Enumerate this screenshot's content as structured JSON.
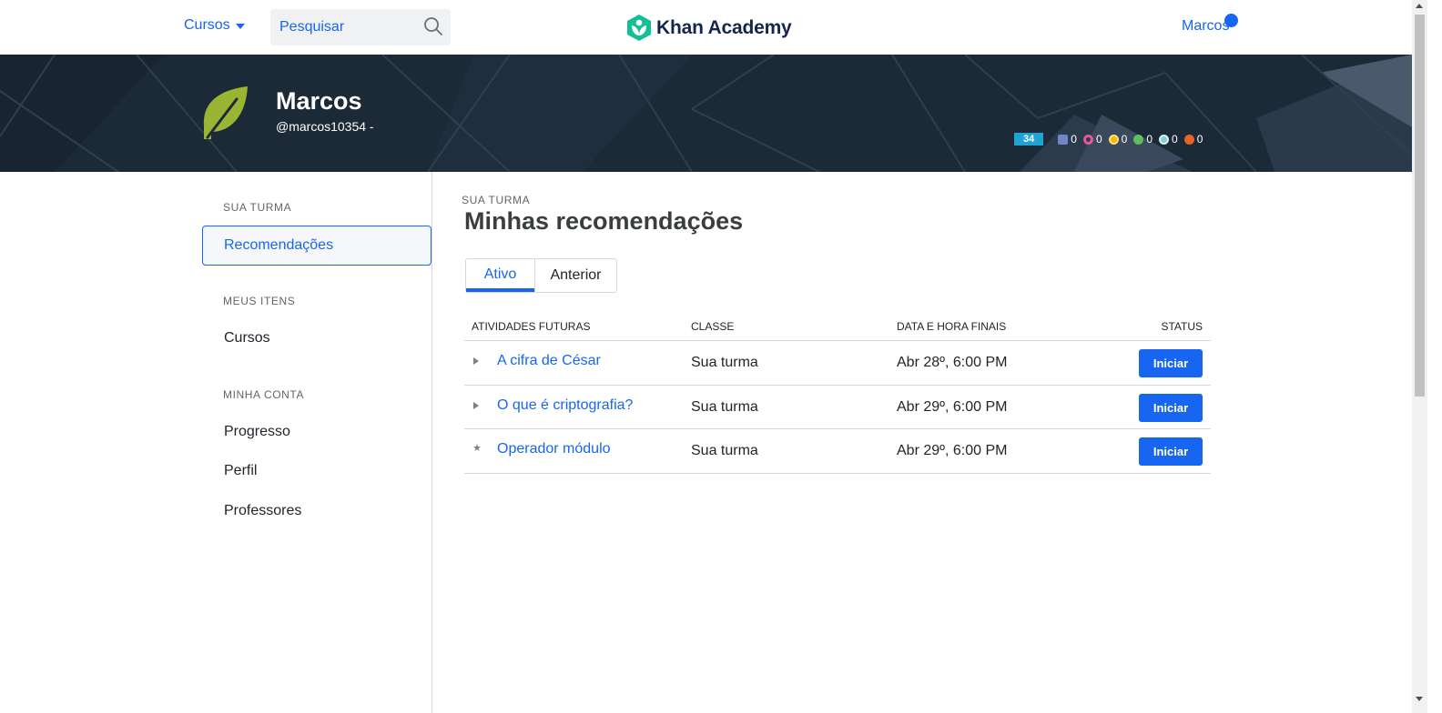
{
  "nav": {
    "courses_label": "Cursos",
    "search_placeholder": "Pesquisar",
    "logo_text": "Khan Academy",
    "user_label": "Marcos"
  },
  "profile": {
    "name": "Marcos",
    "handle": "@marcos10354 -",
    "points": "34",
    "badges": [
      {
        "icon": "challenge-patch-icon",
        "color": "#6f86c7",
        "count": "0"
      },
      {
        "icon": "black-hole-badge-icon",
        "color": "#e5579c",
        "count": "0"
      },
      {
        "icon": "sun-badge-icon",
        "color": "#f5b800",
        "count": "0"
      },
      {
        "icon": "earth-badge-icon",
        "color": "#5fbf5f",
        "count": "0"
      },
      {
        "icon": "moon-badge-icon",
        "color": "#7fd0d8",
        "count": "0"
      },
      {
        "icon": "meteorite-badge-icon",
        "color": "#e4652a",
        "count": "0"
      }
    ]
  },
  "sidebar": {
    "section1": "SUA TURMA",
    "active_item": "Recomendações",
    "section2": "MEUS ITENS",
    "courses": "Cursos",
    "section3": "MINHA CONTA",
    "progress": "Progresso",
    "profile": "Perfil",
    "teachers": "Professores"
  },
  "main": {
    "eyebrow": "SUA TURMA",
    "title": "Minhas recomendações",
    "tabs": [
      "Ativo",
      "Anterior"
    ],
    "columns": [
      "ATIVIDADES FUTURAS",
      "CLASSE",
      "DATA E HORA FINAIS",
      "STATUS"
    ],
    "rows": [
      {
        "activity": "A cifra de César",
        "class": "Sua turma",
        "due": "Abr 28º, 6:00 PM",
        "action": "Iniciar",
        "marker": "expand"
      },
      {
        "activity": "O que é criptografia?",
        "class": "Sua turma",
        "due": "Abr 29º, 6:00 PM",
        "action": "Iniciar",
        "marker": "expand"
      },
      {
        "activity": "Operador módulo",
        "class": "Sua turma",
        "due": "Abr 29º, 6:00 PM",
        "action": "Iniciar",
        "marker": "star"
      }
    ]
  },
  "colors": {
    "brand_blue": "#1865f2",
    "banner_bg": "#1c2a38",
    "logo_green": "#14bf96",
    "avatar_green": "#9ab533"
  }
}
